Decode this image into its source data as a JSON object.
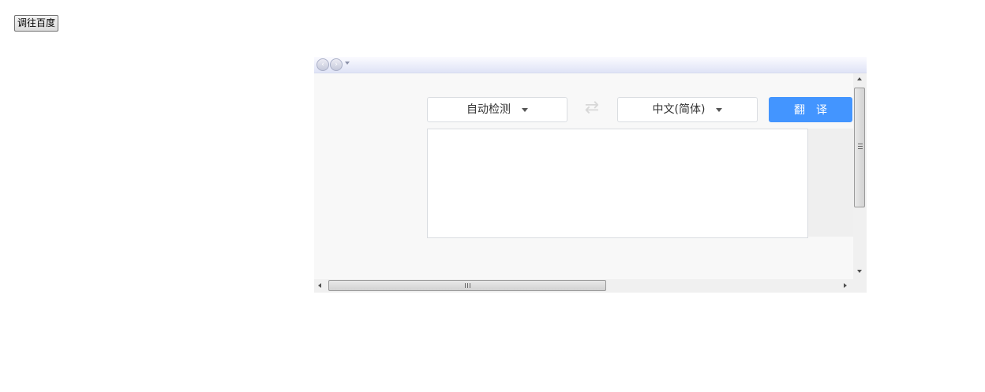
{
  "page": {
    "goto_button_label": "调往百度"
  },
  "translator": {
    "source_language": "自动检测",
    "target_language": "中文(简体)",
    "swap_symbol": "⇄",
    "translate_label": "翻译",
    "input_value": "",
    "accent_color": "#4395ff"
  },
  "browser_frame": {
    "back_icon": "back-arrow-icon",
    "forward_icon": "forward-arrow-icon"
  }
}
